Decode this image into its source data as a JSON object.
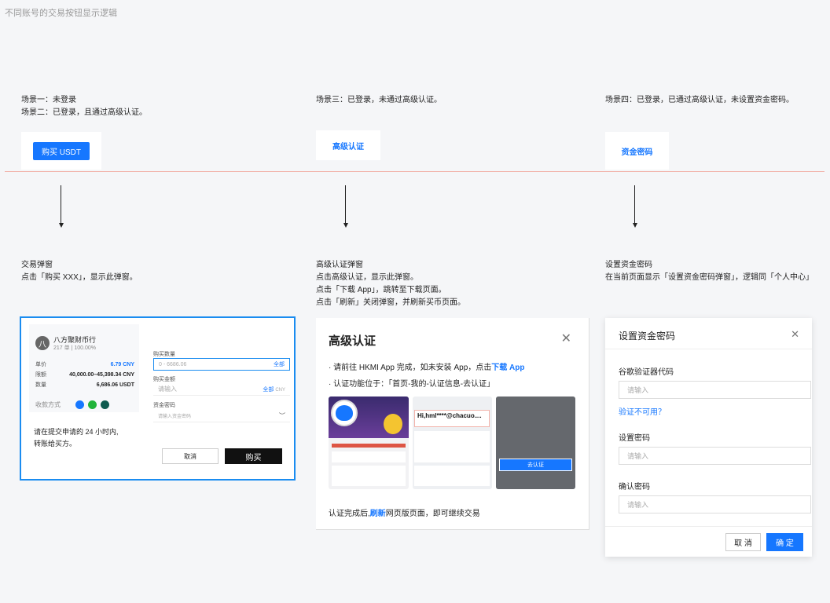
{
  "page_title": "不同账号的交易按钮显示逻辑",
  "col1": {
    "scenario_line1": "场景一：未登录",
    "scenario_line2": "场景二：已登录，且通过高级认证。",
    "button_label": "购买 USDT",
    "desc_title": "交易弹窗",
    "desc_line1": "点击「购买 XXX」，显示此弹窗。"
  },
  "col2": {
    "scenario_line1": "场景三：已登录，未通过高级认证。",
    "link_label": "高级认证",
    "desc_title": "高级认证弹窗",
    "desc_line1": "点击高级认证，显示此弹窗。",
    "desc_line2": "点击「下载 App」，跳转至下载页面。",
    "desc_line3": "点击「刷新」关闭弹窗，并刷新买币页面。"
  },
  "col3": {
    "scenario_line1": "场景四：已登录，已通过高级认证，未设置资金密码。",
    "link_label": "资金密码",
    "desc_title": "设置资金密码",
    "desc_line1": "在当前页面显示「设置资金密码弹窗」，逻辑同「个人中心」"
  },
  "trade_dialog": {
    "avatar_char": "八",
    "merchant_name": "八方聚财币行",
    "merchant_stats": "217 单 | 100.00%",
    "price_label": "单价",
    "price_value": "6.79 CNY",
    "limit_label": "限额",
    "limit_value": "40,000.00–45,398.34 CNY",
    "qty_label": "数量",
    "qty_value": "6,686.06 USDT",
    "payment_label": "收款方式",
    "notice_line1": "请在提交申请的 24 小时内,",
    "notice_line2": "转账给买方。",
    "buy_qty_label": "购买数量",
    "buy_qty_placeholder": "0 - 6686.06",
    "buy_qty_all": "全部",
    "buy_amount_label": "购买金额",
    "buy_amount_placeholder": "请输入",
    "buy_amount_all": "全部",
    "buy_amount_unit": "CNY",
    "fund_pwd_label": "资金密码",
    "fund_pwd_placeholder": "请输入资金密码",
    "cancel_label": "取消",
    "buy_label": "购买"
  },
  "kyc_dialog": {
    "title": "高级认证",
    "line1_prefix": "· 请前往 HKMI App 完成，如未安装 App，点击",
    "line1_link": "下载 App",
    "line2": "· 认证功能位于：「首页-我的-认证信息-去认证」",
    "shot2_text": "Hi,hml****@chacuo....",
    "shot3_button": "去认证",
    "footer_prefix": "认证完成后,",
    "footer_link": "刷新",
    "footer_suffix": "网页版页面，即可继续交易"
  },
  "pwd_dialog": {
    "title": "设置资金密码",
    "google_label": "谷歌验证器代码",
    "google_placeholder": "请输入",
    "unavailable_link": "验证不可用？",
    "set_pwd_label": "设置密码",
    "set_pwd_placeholder": "请输入",
    "confirm_pwd_label": "确认密码",
    "confirm_pwd_placeholder": "请输入",
    "cancel_label": "取 消",
    "ok_label": "确 定"
  },
  "colors": {
    "accent": "#1677ff",
    "divider": "#f2b3aa"
  }
}
